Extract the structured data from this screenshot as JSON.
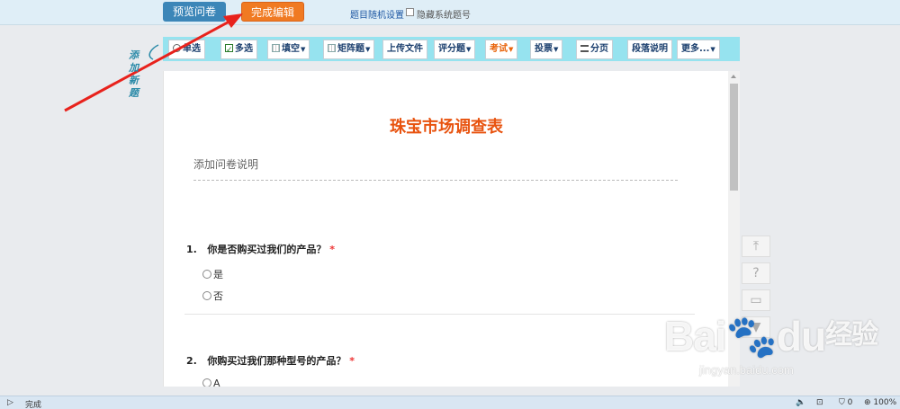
{
  "header": {
    "preview_label": "预览问卷",
    "finish_label": "完成编辑",
    "random_link": "题目随机设置",
    "hide_numbers_label": "隐藏系统题号"
  },
  "toolbar": {
    "single": "单选",
    "multi": "多选",
    "fill": "填空",
    "matrix": "矩阵题",
    "upload": "上传文件",
    "rating": "评分题",
    "exam": "考试",
    "vote": "投票",
    "page": "分页",
    "paragraph": "段落说明",
    "more": "更多..."
  },
  "annotation": {
    "handwritten": "添加新题",
    "arrow_color": "#e8221c"
  },
  "survey": {
    "title": "珠宝市场调查表",
    "description": "添加问卷说明",
    "questions": [
      {
        "number": "1.",
        "text": "你是否购买过我们的产品？",
        "required": "*",
        "options": [
          "是",
          "否"
        ]
      },
      {
        "number": "2.",
        "text": "你购买过我们那种型号的产品？",
        "required": "*",
        "options": [
          "A"
        ]
      }
    ]
  },
  "status": {
    "text": "完成",
    "zoom": "100%",
    "count": "0"
  },
  "watermark": {
    "logo": "Bai",
    "logo2": "du",
    "logo_cn": "经验",
    "url": "jingyan.baidu.com"
  },
  "colors": {
    "accent_orange": "#f07a22",
    "preview_blue": "#3c86b8",
    "toolbar_bg": "#96e3ef",
    "title_orange": "#e8530f"
  }
}
